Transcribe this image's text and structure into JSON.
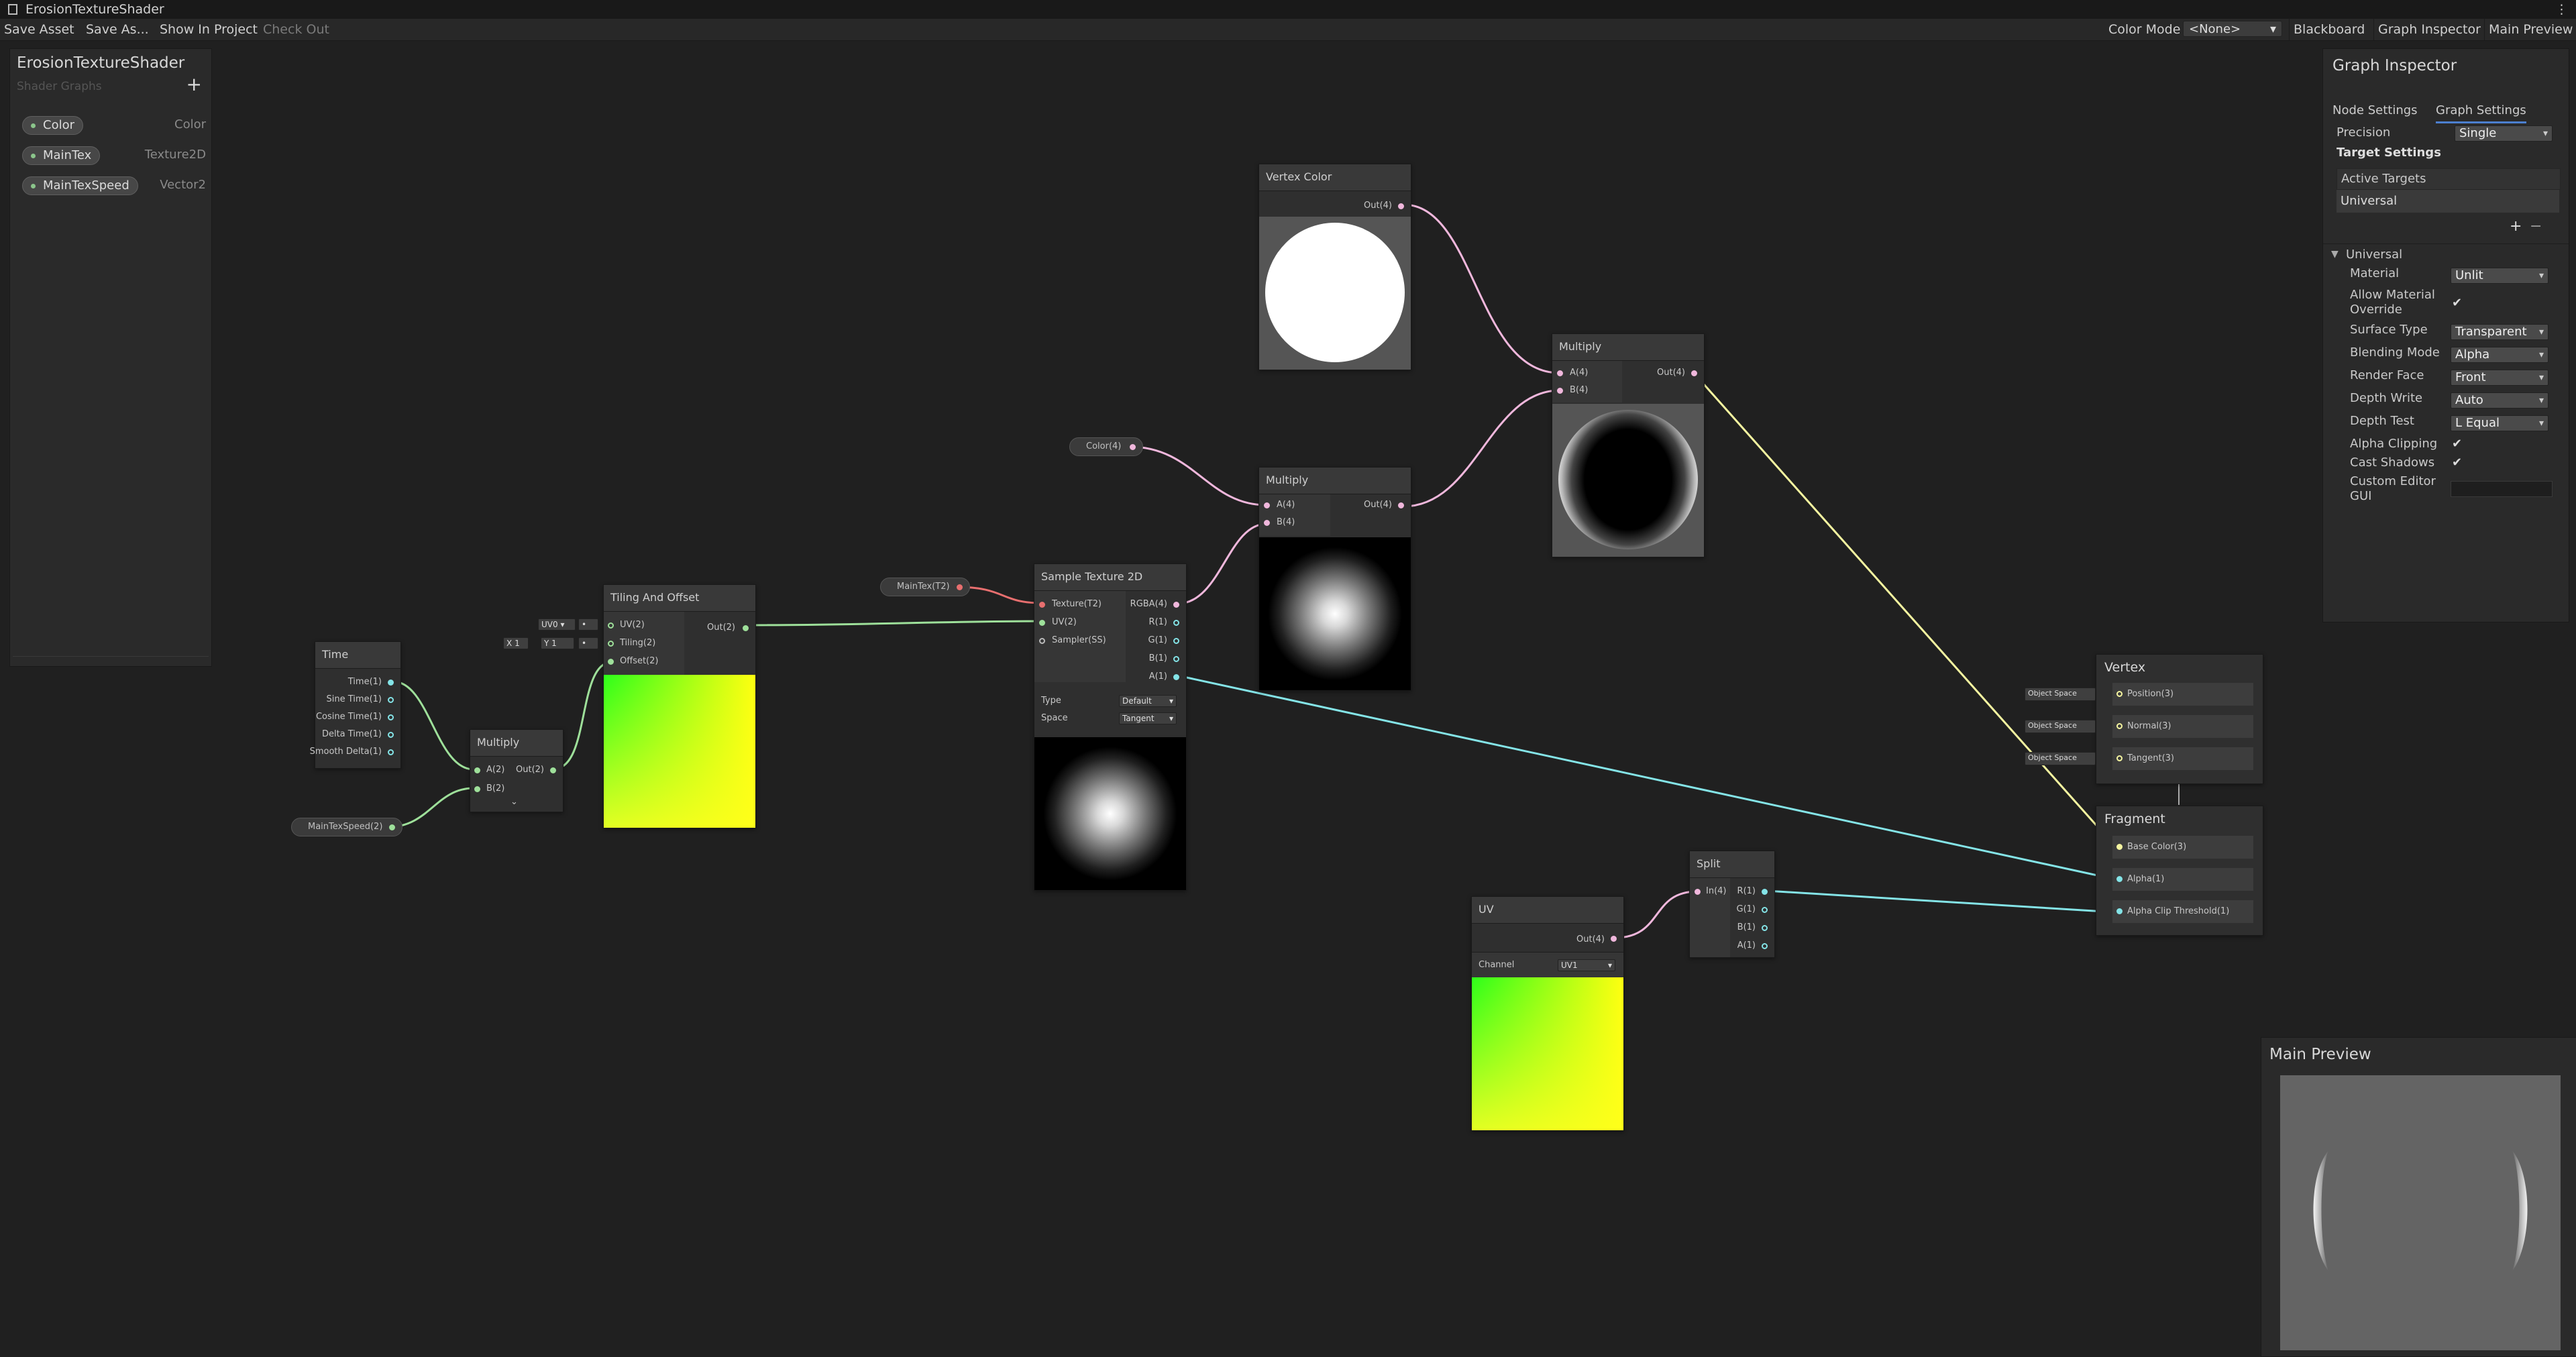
{
  "window": {
    "title": "ErosionTextureShader"
  },
  "toolbar": {
    "save_asset": "Save Asset",
    "save_as": "Save As...",
    "show_in_project": "Show In Project",
    "check_out": "Check Out",
    "color_mode_label": "Color Mode",
    "color_mode_value": "<None>",
    "blackboard": "Blackboard",
    "graph_inspector": "Graph Inspector",
    "main_preview": "Main Preview"
  },
  "blackboard": {
    "title": "ErosionTextureShader",
    "subtitle": "Shader Graphs",
    "add": "+",
    "properties": [
      {
        "name": "Color",
        "type": "Color"
      },
      {
        "name": "MainTex",
        "type": "Texture2D"
      },
      {
        "name": "MainTexSpeed",
        "type": "Vector2"
      }
    ]
  },
  "nodes": {
    "time": {
      "title": "Time",
      "outputs": [
        "Time(1)",
        "Sine Time(1)",
        "Cosine Time(1)",
        "Delta Time(1)",
        "Smooth Delta(1)"
      ]
    },
    "maintexspeed": {
      "label": "MainTexSpeed(2)"
    },
    "multiply1": {
      "title": "Multiply",
      "in_a": "A(2)",
      "in_b": "B(2)",
      "out": "Out(2)",
      "expand": "⌄"
    },
    "tiling": {
      "title": "Tiling And Offset",
      "in_uv": "UV(2)",
      "in_tiling": "Tiling(2)",
      "in_offset": "Offset(2)",
      "out": "Out(2)",
      "uv_select": "UV0",
      "x_label": "X",
      "x_value": "1",
      "y_label": "Y",
      "y_value": "1"
    },
    "maintex": {
      "label": "MainTex(T2)"
    },
    "sample": {
      "title": "Sample Texture 2D",
      "inputs": [
        "Texture(T2)",
        "UV(2)",
        "Sampler(SS)"
      ],
      "outputs": [
        "RGBA(4)",
        "R(1)",
        "G(1)",
        "B(1)",
        "A(1)"
      ],
      "type_label": "Type",
      "type_value": "Default",
      "space_label": "Space",
      "space_value": "Tangent"
    },
    "color": {
      "label": "Color(4)"
    },
    "vertex_color": {
      "title": "Vertex Color",
      "out": "Out(4)"
    },
    "multiply2": {
      "title": "Multiply",
      "in_a": "A(4)",
      "in_b": "B(4)",
      "out": "Out(4)"
    },
    "multiply3": {
      "title": "Multiply",
      "in_a": "A(4)",
      "in_b": "B(4)",
      "out": "Out(4)"
    },
    "uv": {
      "title": "UV",
      "out": "Out(4)",
      "channel_label": "Channel",
      "channel_value": "UV1"
    },
    "split": {
      "title": "Split",
      "in": "In(4)",
      "outputs": [
        "R(1)",
        "G(1)",
        "B(1)",
        "A(1)"
      ]
    },
    "vertex": {
      "title": "Vertex",
      "space": "Object Space",
      "ports": [
        "Position(3)",
        "Normal(3)",
        "Tangent(3)"
      ]
    },
    "fragment": {
      "title": "Fragment",
      "ports": [
        "Base Color(3)",
        "Alpha(1)",
        "Alpha Clip Threshold(1)"
      ]
    }
  },
  "inspector": {
    "title": "Graph Inspector",
    "tab_node": "Node Settings",
    "tab_graph": "Graph Settings",
    "precision_label": "Precision",
    "precision_value": "Single",
    "target_settings": "Target Settings",
    "active_targets": "Active Targets",
    "target_item": "Universal",
    "add": "+",
    "remove": "−",
    "section": "Universal",
    "rows": [
      {
        "label": "Material",
        "value": "Unlit",
        "kind": "drop"
      },
      {
        "label": "Allow Material Override",
        "value": "✔",
        "kind": "check"
      },
      {
        "label": "Surface Type",
        "value": "Transparent",
        "kind": "drop"
      },
      {
        "label": "Blending Mode",
        "value": "Alpha",
        "kind": "drop"
      },
      {
        "label": "Render Face",
        "value": "Front",
        "kind": "drop"
      },
      {
        "label": "Depth Write",
        "value": "Auto",
        "kind": "drop"
      },
      {
        "label": "Depth Test",
        "value": "L Equal",
        "kind": "drop"
      },
      {
        "label": "Alpha Clipping",
        "value": "✔",
        "kind": "check"
      },
      {
        "label": "Cast Shadows",
        "value": "✔",
        "kind": "check"
      },
      {
        "label": "Custom Editor GUI",
        "value": "",
        "kind": "field"
      }
    ]
  },
  "main_preview": {
    "title": "Main Preview"
  },
  "colors": {
    "vec2": "#9ee09a",
    "vec4": "#f0b7dc",
    "vec3": "#f5f5a0",
    "float": "#84e4e7",
    "tex": "#e86f6f"
  }
}
